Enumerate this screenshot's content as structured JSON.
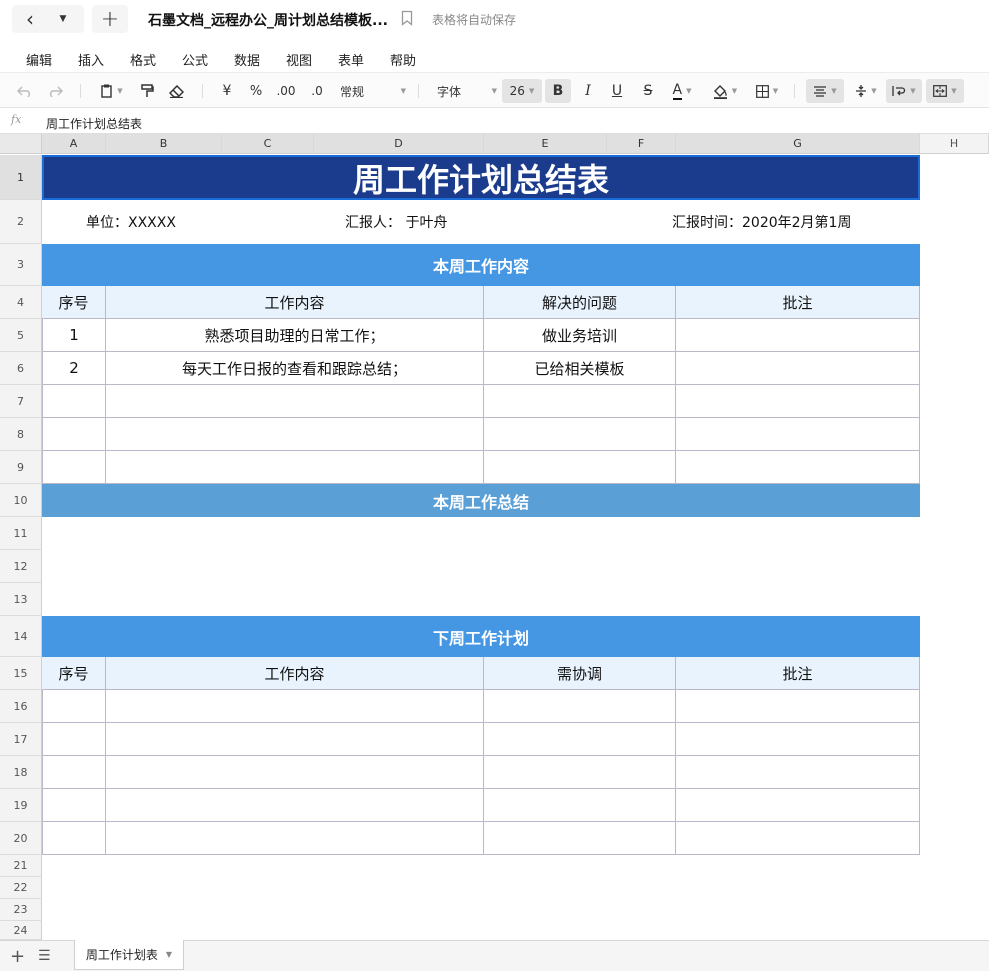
{
  "titlebar": {
    "back_icon": "chevron-left-icon",
    "new_icon": "plus-icon",
    "doc_title": "石墨文档_远程办公_周计划总结模板...",
    "save_status": "表格将自动保存"
  },
  "menu": [
    "编辑",
    "插入",
    "格式",
    "公式",
    "数据",
    "视图",
    "表单",
    "帮助"
  ],
  "toolbar": {
    "currency": "¥",
    "percent": "%",
    "decimal_add": ".00",
    "decimal_remove": ".0",
    "number_format": "常规",
    "font_family": "字体",
    "font_size": "26",
    "bold": "B",
    "italic": "I",
    "underline": "U",
    "strike": "S",
    "text_color_glyph": "A"
  },
  "formula_bar": {
    "fx_label": "fx",
    "value": "周工作计划总结表"
  },
  "columns": [
    "A",
    "B",
    "C",
    "D",
    "E",
    "F",
    "G",
    "H"
  ],
  "rows": [
    "1",
    "2",
    "3",
    "4",
    "5",
    "6",
    "7",
    "8",
    "9",
    "10",
    "11",
    "12",
    "13",
    "14",
    "15",
    "16",
    "17",
    "18",
    "19",
    "20",
    "21",
    "22",
    "23",
    "24"
  ],
  "sheet": {
    "title": "周工作计划总结表",
    "unit": "单位：XXXXX",
    "reporter": "汇报人：  于叶舟",
    "report_time": "汇报时间：2020年2月第1周",
    "section_this_week": "本周工作内容",
    "table1_headers": [
      "序号",
      "工作内容",
      "解决的问题",
      "批注"
    ],
    "table1_rows": [
      [
        "1",
        "熟悉项目助理的日常工作；",
        "做业务培训",
        ""
      ],
      [
        "2",
        "每天工作日报的查看和跟踪总结；",
        "已给相关模板",
        ""
      ],
      [
        "",
        "",
        "",
        ""
      ],
      [
        "",
        "",
        "",
        ""
      ],
      [
        "",
        "",
        "",
        ""
      ]
    ],
    "section_summary": "本周工作总结",
    "section_next_week": "下周工作计划",
    "table2_headers": [
      "序号",
      "工作内容",
      "需协调",
      "批注"
    ],
    "table2_rows": [
      [
        "",
        "",
        "",
        ""
      ],
      [
        "",
        "",
        "",
        ""
      ],
      [
        "",
        "",
        "",
        ""
      ],
      [
        "",
        "",
        "",
        ""
      ],
      [
        "",
        "",
        "",
        ""
      ]
    ]
  },
  "tabs": {
    "active": "周工作计划表"
  },
  "colors": {
    "title_bg": "#1b3b8c",
    "band_bg": "#4597e4",
    "band_mid_bg": "#5b9fd7",
    "header_bg": "#e8f3fd",
    "selection": "#1a6cd8"
  }
}
